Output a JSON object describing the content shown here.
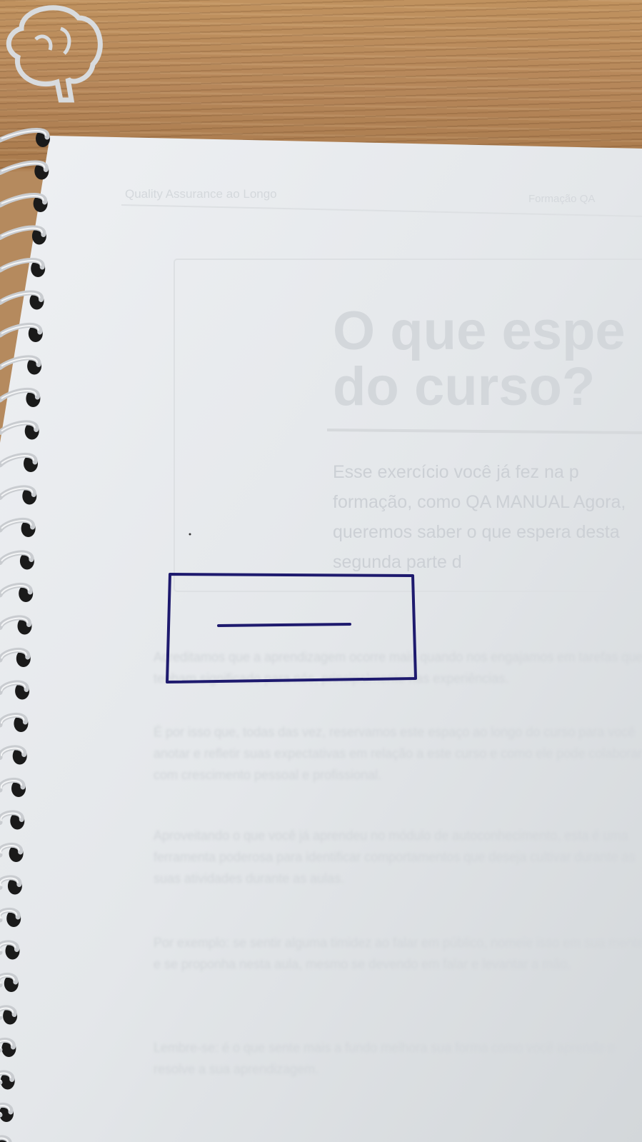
{
  "scene": {
    "background": "wooden-desk",
    "object": "spiral-notebook-page",
    "colors": {
      "paper": "#e6e9ec",
      "ink": "#1e1a6e",
      "wood": "#b6875a",
      "faint_print": "#cfd3d8"
    }
  },
  "printed": {
    "header_left": "Quality Assurance ao Longo",
    "header_right": "Formação QA",
    "title": "O que espe\ndo curso?",
    "intro": "Esse exercício você já fez na p formação, como QA MANUAL Agora, queremos saber o que espera desta segunda parte d",
    "paragraphs": [
      "Acreditamos que a aprendizagem ocorre mais quando nos engajamos em tarefas que tenham significado para nós, principalmente nas experiências.",
      "É por isso que, todas das vez, reservamos este espaço ao longo do curso para você anotar e refletir suas expectativas em relação a este curso e como ele pode colaborar com crescimento pessoal e profissional.",
      "Aproveitando o que você já aprendeu no módulo de autoconhecimento, esta é uma ferramenta poderosa para identificar comportamentos que deseja cultivar durante as suas atividades durante as aulas.",
      "Por exemplo: se sentir alguma timidez ao falar em público, nomeie isso em sua mente e se proponha nesta aula, mesmo se devendo em falar e levantar a mão.",
      "Lembre-se: é o que sente mais a fundo melhora sua forma como você aprende e resolve a sua aprendizagem."
    ]
  }
}
